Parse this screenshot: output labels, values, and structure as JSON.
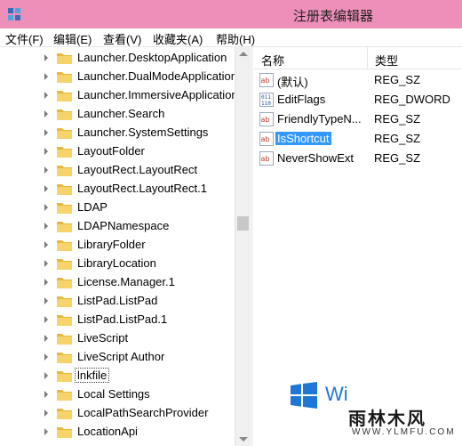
{
  "window": {
    "title": "注册表编辑器",
    "app_icon": "regedit-icon"
  },
  "menu": [
    {
      "label": "文件(F)"
    },
    {
      "label": "编辑(E)"
    },
    {
      "label": "查看(V)"
    },
    {
      "label": "收藏夹(A)"
    },
    {
      "label": "帮助(H)"
    }
  ],
  "tree": {
    "items": [
      {
        "label": "Launcher.DesktopApplication"
      },
      {
        "label": "Launcher.DualModeApplication"
      },
      {
        "label": "Launcher.ImmersiveApplication"
      },
      {
        "label": "Launcher.Search"
      },
      {
        "label": "Launcher.SystemSettings"
      },
      {
        "label": "LayoutFolder"
      },
      {
        "label": "LayoutRect.LayoutRect"
      },
      {
        "label": "LayoutRect.LayoutRect.1"
      },
      {
        "label": "LDAP"
      },
      {
        "label": "LDAPNamespace"
      },
      {
        "label": "LibraryFolder"
      },
      {
        "label": "LibraryLocation"
      },
      {
        "label": "License.Manager.1"
      },
      {
        "label": "ListPad.ListPad"
      },
      {
        "label": "ListPad.ListPad.1"
      },
      {
        "label": "LiveScript"
      },
      {
        "label": "LiveScript Author"
      },
      {
        "label": "lnkfile",
        "focused": true
      },
      {
        "label": "Local Settings"
      },
      {
        "label": "LocalPathSearchProvider"
      },
      {
        "label": "LocationApi"
      }
    ]
  },
  "list": {
    "columns": [
      {
        "label": "名称"
      },
      {
        "label": "类型"
      }
    ],
    "rows": [
      {
        "name": "(默认)",
        "type": "REG_SZ",
        "icon": "string-value-icon"
      },
      {
        "name": "EditFlags",
        "type": "REG_DWORD",
        "icon": "binary-value-icon"
      },
      {
        "name": "FriendlyTypeN...",
        "type": "REG_SZ",
        "icon": "string-value-icon"
      },
      {
        "name": "IsShortcut",
        "type": "REG_SZ",
        "icon": "string-value-icon",
        "selected": true
      },
      {
        "name": "NeverShowExt",
        "type": "REG_SZ",
        "icon": "string-value-icon"
      }
    ]
  },
  "watermark": {
    "text": "Wi",
    "badge_line1": "雨林木风",
    "badge_line2": "WWW.YLMFU.COM"
  },
  "colors": {
    "titlebar": "#ed8fb9",
    "selection": "#3399ff",
    "watermark_blue": "#1e77d6"
  }
}
